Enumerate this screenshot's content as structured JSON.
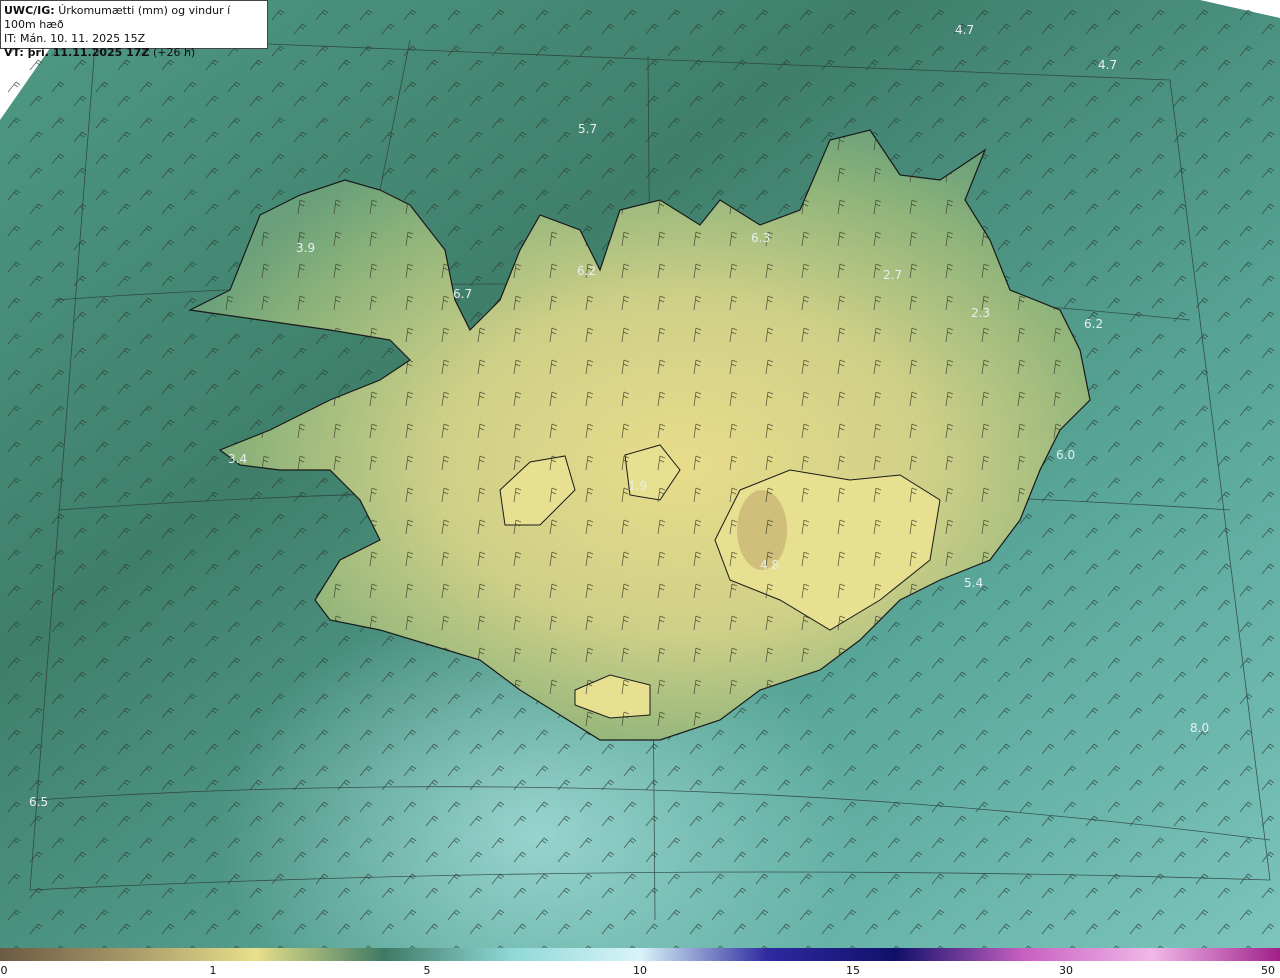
{
  "header": {
    "model": "UWC/IG:",
    "title": "Úrkomumætti (mm) og vindur í 100m hæð",
    "init_time": "IT: Mán. 10. 11. 2025 15Z",
    "valid_prefix": "VT: þri. 11.11.2025 17Z",
    "valid_suffix": "(+26 h)"
  },
  "map_labels": [
    {
      "id": "label-1",
      "text": "4.7"
    },
    {
      "id": "label-2",
      "text": "4.7"
    },
    {
      "id": "label-3",
      "text": "5.7"
    },
    {
      "id": "label-4",
      "text": "3.9"
    },
    {
      "id": "label-5",
      "text": "6.7"
    },
    {
      "id": "label-6",
      "text": "6.2"
    },
    {
      "id": "label-7",
      "text": "6.3"
    },
    {
      "id": "label-8",
      "text": "2.7"
    },
    {
      "id": "label-9",
      "text": "2.3"
    },
    {
      "id": "label-10",
      "text": "6.2"
    },
    {
      "id": "label-11",
      "text": "3.4"
    },
    {
      "id": "label-12",
      "text": "1.9"
    },
    {
      "id": "label-13",
      "text": "4.8"
    },
    {
      "id": "label-14",
      "text": "6.0"
    },
    {
      "id": "label-15",
      "text": "5.4"
    },
    {
      "id": "label-16",
      "text": "8.0"
    },
    {
      "id": "label-17",
      "text": "6.5"
    }
  ],
  "colorbar": {
    "ticks": [
      "0",
      "1",
      "5",
      "10",
      "15",
      "30",
      "50"
    ],
    "colors": [
      "#6b5a44",
      "#a89868",
      "#e8e08a",
      "#3f7a64",
      "#8fd8d8",
      "#d8f4f8",
      "#2e2aa0",
      "#10106a",
      "#c860c0",
      "#f0b8e8",
      "#a0208a"
    ]
  },
  "colors": {
    "ocean": "#4e9a8a",
    "land_high": "#e4da86",
    "land_mid": "#9cb878",
    "coast": "#1a1a1a",
    "grid": "#2a3a36"
  }
}
